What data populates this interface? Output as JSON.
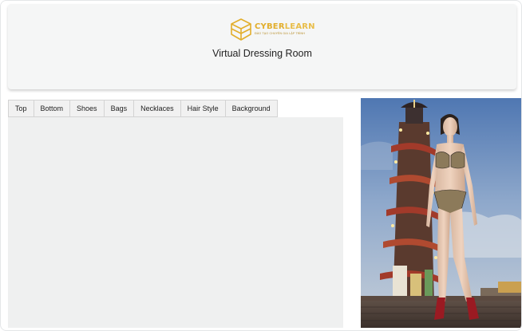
{
  "header": {
    "logo": {
      "name_part1": "CYBER",
      "name_part2": "LEARN",
      "tagline": "ĐÀO TẠO CHUYÊN GIA LẬP TRÌNH"
    },
    "title": "Virtual Dressing Room"
  },
  "tabs": [
    {
      "label": "Top"
    },
    {
      "label": "Bottom"
    },
    {
      "label": "Shoes"
    },
    {
      "label": "Bags"
    },
    {
      "label": "Necklaces"
    },
    {
      "label": "Hair Style"
    },
    {
      "label": "Background"
    }
  ],
  "colors": {
    "brand": "#e2ae2c",
    "header_bg": "#f5f6f6",
    "panel_bg": "#eff0f0",
    "tab_bg": "#f1f1f1"
  },
  "icons": {
    "logo": "cube-icon"
  }
}
